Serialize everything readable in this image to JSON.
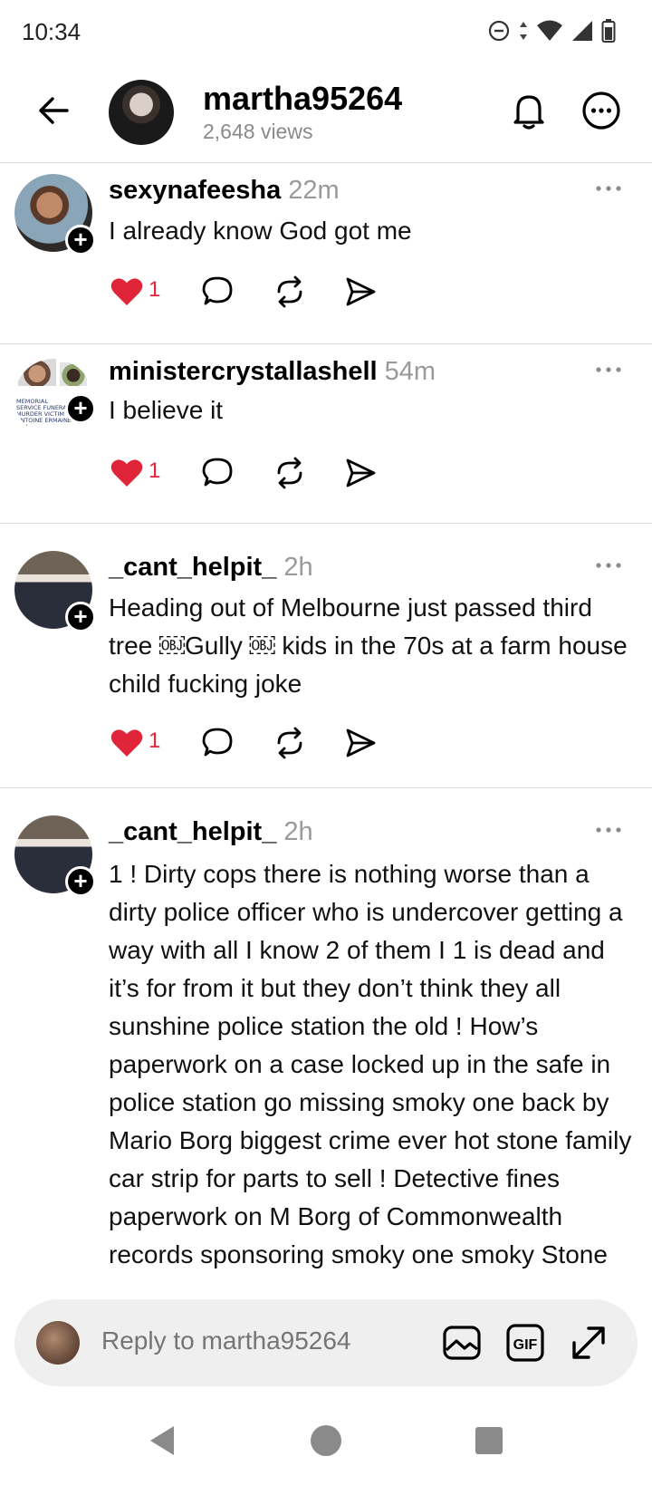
{
  "status_bar": {
    "time": "10:34"
  },
  "header": {
    "title": "martha95264",
    "subtitle": "2,648 views"
  },
  "posts": [
    {
      "username": "sexynafeesha",
      "time": "22m",
      "text": "I already know God got me",
      "likes": "1"
    },
    {
      "username": "ministercrystallashell",
      "time": "54m",
      "text": "I believe it",
      "likes": "1",
      "avatar_text": "MEMORIAL SERVICE FUNERAL MURDER VICTIM ANTOINE ERMAINE LAX"
    },
    {
      "username": "_cant_helpit_",
      "time": "2h",
      "text": "Heading out of Melbourne just passed third tree ￼Gully ￼  kids in the 70s  at a farm house child fucking joke",
      "likes": "1"
    },
    {
      "username": "_cant_helpit_",
      "time": "2h",
      "text": "1 ! Dirty cops there is nothing worse than a dirty police officer who is undercover getting a way with all I know 2 of them I 1 is dead and it’s for from it but they don’t think they all sunshine police station the old ! How’s paperwork  on a case locked up in the safe in police station go missing smoky one back by Mario Borg biggest crime ever hot stone family  car strip for parts to sell ! Detective  fines paperwork  on M Borg of Commonwealth records sponsoring smoky one smoky Stone"
    }
  ],
  "reply": {
    "placeholder": "Reply to martha95264",
    "gif_label": "GIF"
  },
  "colors": {
    "like": "#e0243a",
    "muted": "#9a9a9a",
    "divider": "#dcdcdc",
    "reply_bg": "#efefef"
  }
}
